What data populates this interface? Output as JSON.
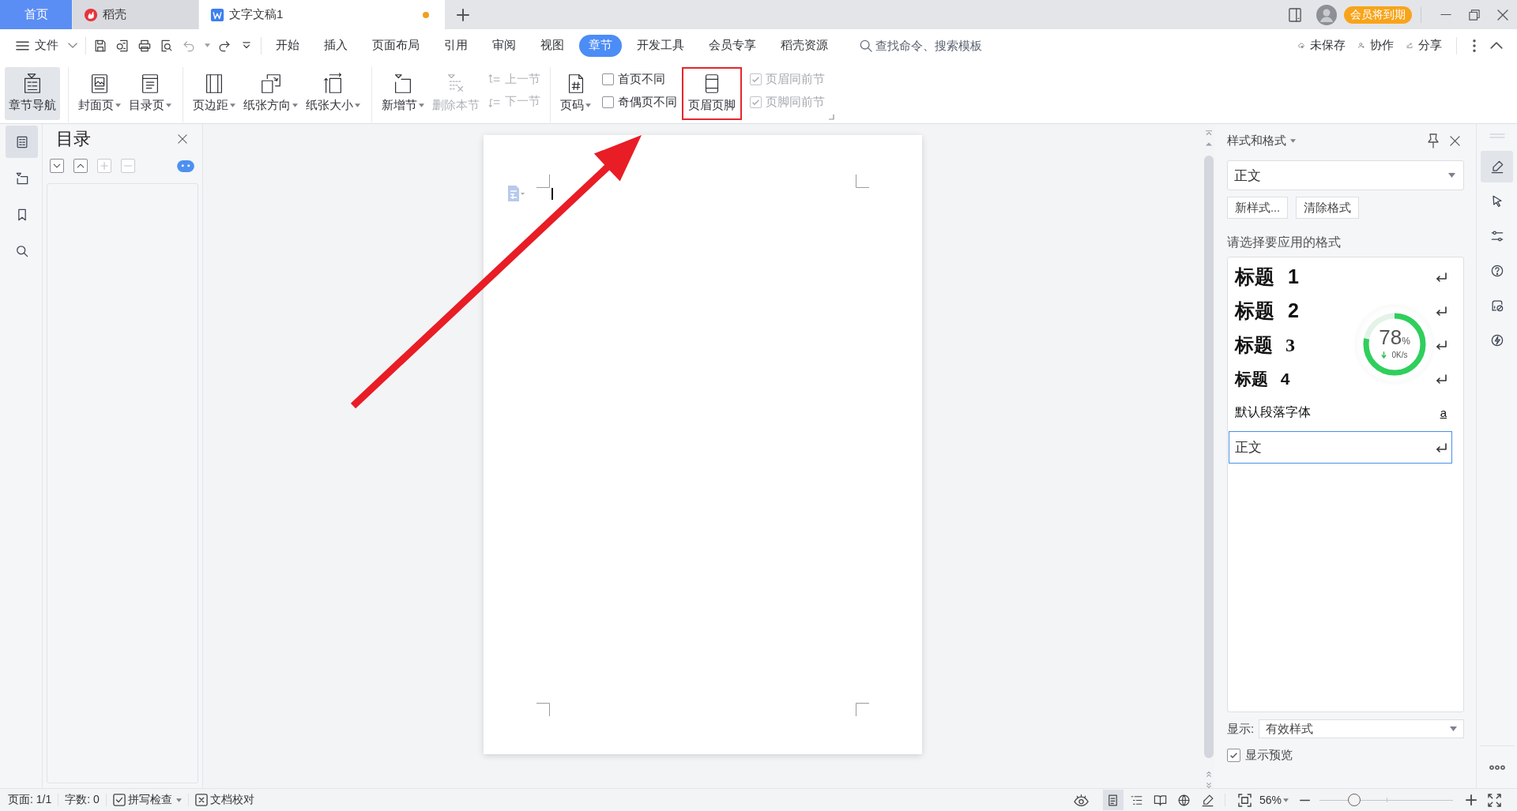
{
  "tabs": [
    {
      "label": "首页",
      "kind": "home",
      "selected": false,
      "modified": false
    },
    {
      "label": "稻壳",
      "kind": "docer",
      "selected": false,
      "modified": false
    },
    {
      "label": "文字文稿1",
      "kind": "writer",
      "selected": true,
      "modified": true
    }
  ],
  "title_bar": {
    "badge": "会员将到期"
  },
  "menu": {
    "file": "文件",
    "tabs": [
      {
        "label": "开始",
        "selected": false
      },
      {
        "label": "插入",
        "selected": false
      },
      {
        "label": "页面布局",
        "selected": false
      },
      {
        "label": "引用",
        "selected": false
      },
      {
        "label": "审阅",
        "selected": false
      },
      {
        "label": "视图",
        "selected": false
      },
      {
        "label": "章节",
        "selected": true
      },
      {
        "label": "开发工具",
        "selected": false
      },
      {
        "label": "会员专享",
        "selected": false
      },
      {
        "label": "稻壳资源",
        "selected": false
      }
    ],
    "search": {
      "placeholder": "查找命令、搜索模板"
    },
    "actions": [
      {
        "label": "未保存"
      },
      {
        "label": "协作"
      },
      {
        "label": "分享"
      }
    ]
  },
  "ribbon": {
    "groups": [
      {
        "items": [
          {
            "kind": "large",
            "label": "章节导航",
            "selected": true,
            "dropdown": false,
            "disabled": false,
            "highlighted": false
          }
        ]
      },
      {
        "items": [
          {
            "kind": "large",
            "label": "封面页",
            "selected": false,
            "dropdown": true,
            "disabled": false,
            "highlighted": false
          },
          {
            "kind": "large",
            "label": "目录页",
            "selected": false,
            "dropdown": true,
            "disabled": false,
            "highlighted": false
          }
        ]
      },
      {
        "items": [
          {
            "kind": "large",
            "label": "页边距",
            "selected": false,
            "dropdown": true,
            "disabled": false,
            "highlighted": false
          },
          {
            "kind": "large",
            "label": "纸张方向",
            "selected": false,
            "dropdown": true,
            "disabled": false,
            "highlighted": false
          },
          {
            "kind": "large",
            "label": "纸张大小",
            "selected": false,
            "dropdown": true,
            "disabled": false,
            "highlighted": false
          }
        ]
      },
      {
        "items": [
          {
            "kind": "large",
            "label": "新增节",
            "selected": false,
            "dropdown": true,
            "disabled": false,
            "highlighted": false
          },
          {
            "kind": "large",
            "label": "删除本节",
            "selected": false,
            "dropdown": false,
            "disabled": true,
            "highlighted": false
          },
          {
            "kind": "small",
            "buttons": [
              {
                "label": "上一节",
                "disabled": true
              },
              {
                "label": "下一节",
                "disabled": true
              }
            ]
          }
        ]
      },
      {
        "items": [
          {
            "kind": "large",
            "label": "页码",
            "selected": false,
            "dropdown": true,
            "disabled": false,
            "highlighted": false
          },
          {
            "kind": "checks",
            "options": [
              {
                "label": "首页不同",
                "checked": false,
                "disabled": false
              },
              {
                "label": "奇偶页不同",
                "checked": false,
                "disabled": false
              }
            ]
          },
          {
            "kind": "large",
            "label": "页眉页脚",
            "selected": false,
            "dropdown": false,
            "disabled": false,
            "highlighted": true
          },
          {
            "kind": "checks",
            "options": [
              {
                "label": "页眉同前节",
                "checked": true,
                "disabled": true
              },
              {
                "label": "页脚同前节",
                "checked": true,
                "disabled": true
              }
            ]
          }
        ]
      }
    ]
  },
  "left_rail": [
    {
      "selected": true
    },
    {
      "selected": false
    },
    {
      "selected": false
    },
    {
      "selected": false
    }
  ],
  "toc_panel": {
    "title": "目录",
    "tools": [
      {
        "disabled": false
      },
      {
        "disabled": false
      },
      {
        "disabled": true
      },
      {
        "disabled": true
      }
    ]
  },
  "annotation": {
    "arrow": true
  },
  "styles_panel": {
    "title": "样式和格式",
    "current": "正文",
    "buttons": [
      {
        "label": "新样式..."
      },
      {
        "label": "清除格式"
      }
    ],
    "prompt": "请选择要应用的格式",
    "styles": [
      {
        "label": "标题 1",
        "kind": "heading1",
        "selected": false
      },
      {
        "label": "标题 2",
        "kind": "heading2",
        "selected": false
      },
      {
        "label": "标题 3",
        "kind": "heading3",
        "selected": false
      },
      {
        "label": "标题 4",
        "kind": "heading4",
        "selected": false
      },
      {
        "label": "默认段落字体",
        "kind": "character",
        "marker": "a",
        "selected": false
      },
      {
        "label": "正文",
        "kind": "paragraph",
        "selected": true
      }
    ],
    "show": {
      "label": "显示:",
      "value": "有效样式"
    },
    "preview": {
      "label": "显示预览",
      "checked": true
    }
  },
  "speed_widget": {
    "percent": "78",
    "unit": "%",
    "rate": "0K/s",
    "level": 0.78
  },
  "right_rail": [
    {
      "selected": true
    },
    {
      "selected": false
    },
    {
      "selected": false
    },
    {
      "selected": false
    },
    {
      "selected": false
    },
    {
      "selected": false
    }
  ],
  "status_bar": {
    "items": [
      {
        "kind": "text",
        "label": "页面: 1/1",
        "dropdown": false
      },
      {
        "kind": "text",
        "label": "字数: 0",
        "dropdown": false
      },
      {
        "kind": "spell",
        "label": "拼写检查",
        "dropdown": true
      },
      {
        "kind": "proof",
        "label": "文档校对",
        "dropdown": false
      }
    ],
    "views": [
      {
        "selected": true
      },
      {
        "selected": false
      },
      {
        "selected": false
      },
      {
        "selected": false
      },
      {
        "selected": false
      }
    ],
    "zoom": {
      "value": "56%",
      "level": 0.26
    }
  }
}
